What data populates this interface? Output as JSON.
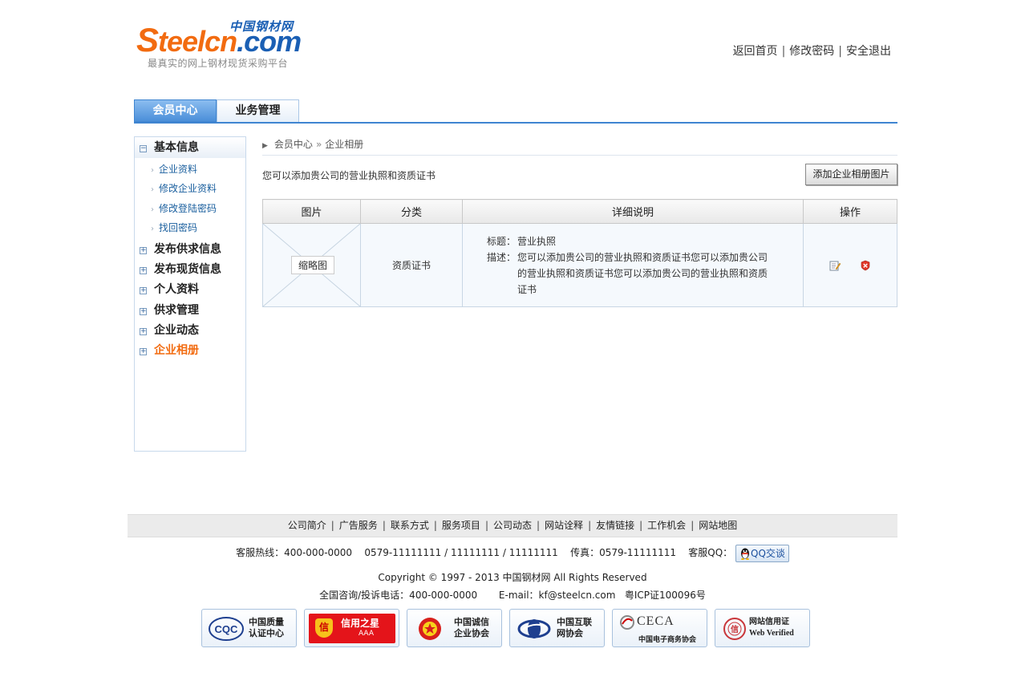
{
  "header": {
    "logo_cn": "中国钢材网",
    "logo_en_s": "S",
    "logo_en_mid": "teelcn",
    "logo_en_tail": ".com",
    "slogan": "最真实的网上钢材现货采购平台",
    "links": [
      "返回首页",
      "修改密码",
      "安全退出"
    ],
    "sep": "|"
  },
  "tabs": [
    "会员中心",
    "业务管理"
  ],
  "sidebar": {
    "groups": [
      {
        "label": "基本信息",
        "expanded": true,
        "items": [
          "企业资料",
          "修改企业资料",
          "修改登陆密码",
          "找回密码"
        ]
      },
      {
        "label": "发布供求信息"
      },
      {
        "label": "发布现货信息"
      },
      {
        "label": "个人资料"
      },
      {
        "label": "供求管理"
      },
      {
        "label": "企业动态"
      },
      {
        "label": "企业相册",
        "active": true
      }
    ],
    "minus": "−",
    "plus": "+",
    "arrow": "›"
  },
  "breadcrumb": {
    "root": "会员中心",
    "sep": "»",
    "current": "企业相册"
  },
  "tip": "您可以添加贵公司的营业执照和资质证书",
  "add_button": "添加企业相册图片",
  "table": {
    "headers": [
      "图片",
      "分类",
      "详细说明",
      "操作"
    ],
    "rows": [
      {
        "thumb_label": "缩略图",
        "category": "资质证书",
        "title_key": "标题：",
        "title": "营业执照",
        "desc_key": "描述：",
        "desc": "您可以添加贵公司的营业执照和资质证书您可以添加贵公司的营业执照和资质证书您可以添加贵公司的营业执照和资质证书"
      }
    ]
  },
  "footer": {
    "nav": [
      "公司简介",
      "广告服务",
      "联系方式",
      "服务项目",
      "公司动态",
      "网站诠释",
      "友情链接",
      "工作机会",
      "网站地图"
    ],
    "sep": "|",
    "hotline": "客服热线：400-000-0000",
    "phones": "0579-11111111 / 11111111 / 11111111",
    "fax": "传真：0579-11111111",
    "qq_label": "客服QQ：",
    "qq_button": "QQ交谈",
    "copyright": "Copyright © 1997 - 2013  中国钢材网 All Rights Reserved",
    "complaint": "全国咨询/投诉电话：400-000-0000",
    "email": "E-mail：kf@steelcn.com",
    "icp": "粤ICP证100096号",
    "badges": [
      {
        "icon": "cqc-logo",
        "lines": [
          "中国质量",
          "认证中心"
        ],
        "ico_text": "CQC"
      },
      {
        "icon": "credit-star-logo",
        "lines": [
          "信用之星",
          "AAA"
        ],
        "ico_text": "信"
      },
      {
        "icon": "integrity-assoc-logo",
        "lines": [
          "中国诚信",
          "企业协会"
        ],
        "ico_text": ""
      },
      {
        "icon": "internet-assoc-logo",
        "lines": [
          "中国互联",
          "网协会"
        ],
        "ico_text": ""
      },
      {
        "icon": "ceca-logo",
        "lines": [
          "CECA",
          "中国电子商务协会"
        ],
        "ico_text": ""
      },
      {
        "icon": "web-verified-logo",
        "lines": [
          "网站信用证",
          "Web Verified"
        ],
        "ico_text": "信"
      }
    ]
  },
  "colors": {
    "brand_blue": "#1a5fb4",
    "brand_orange": "#f26b10",
    "tab_blue": "#4b8fd9",
    "link_blue": "#1a5f9e"
  }
}
